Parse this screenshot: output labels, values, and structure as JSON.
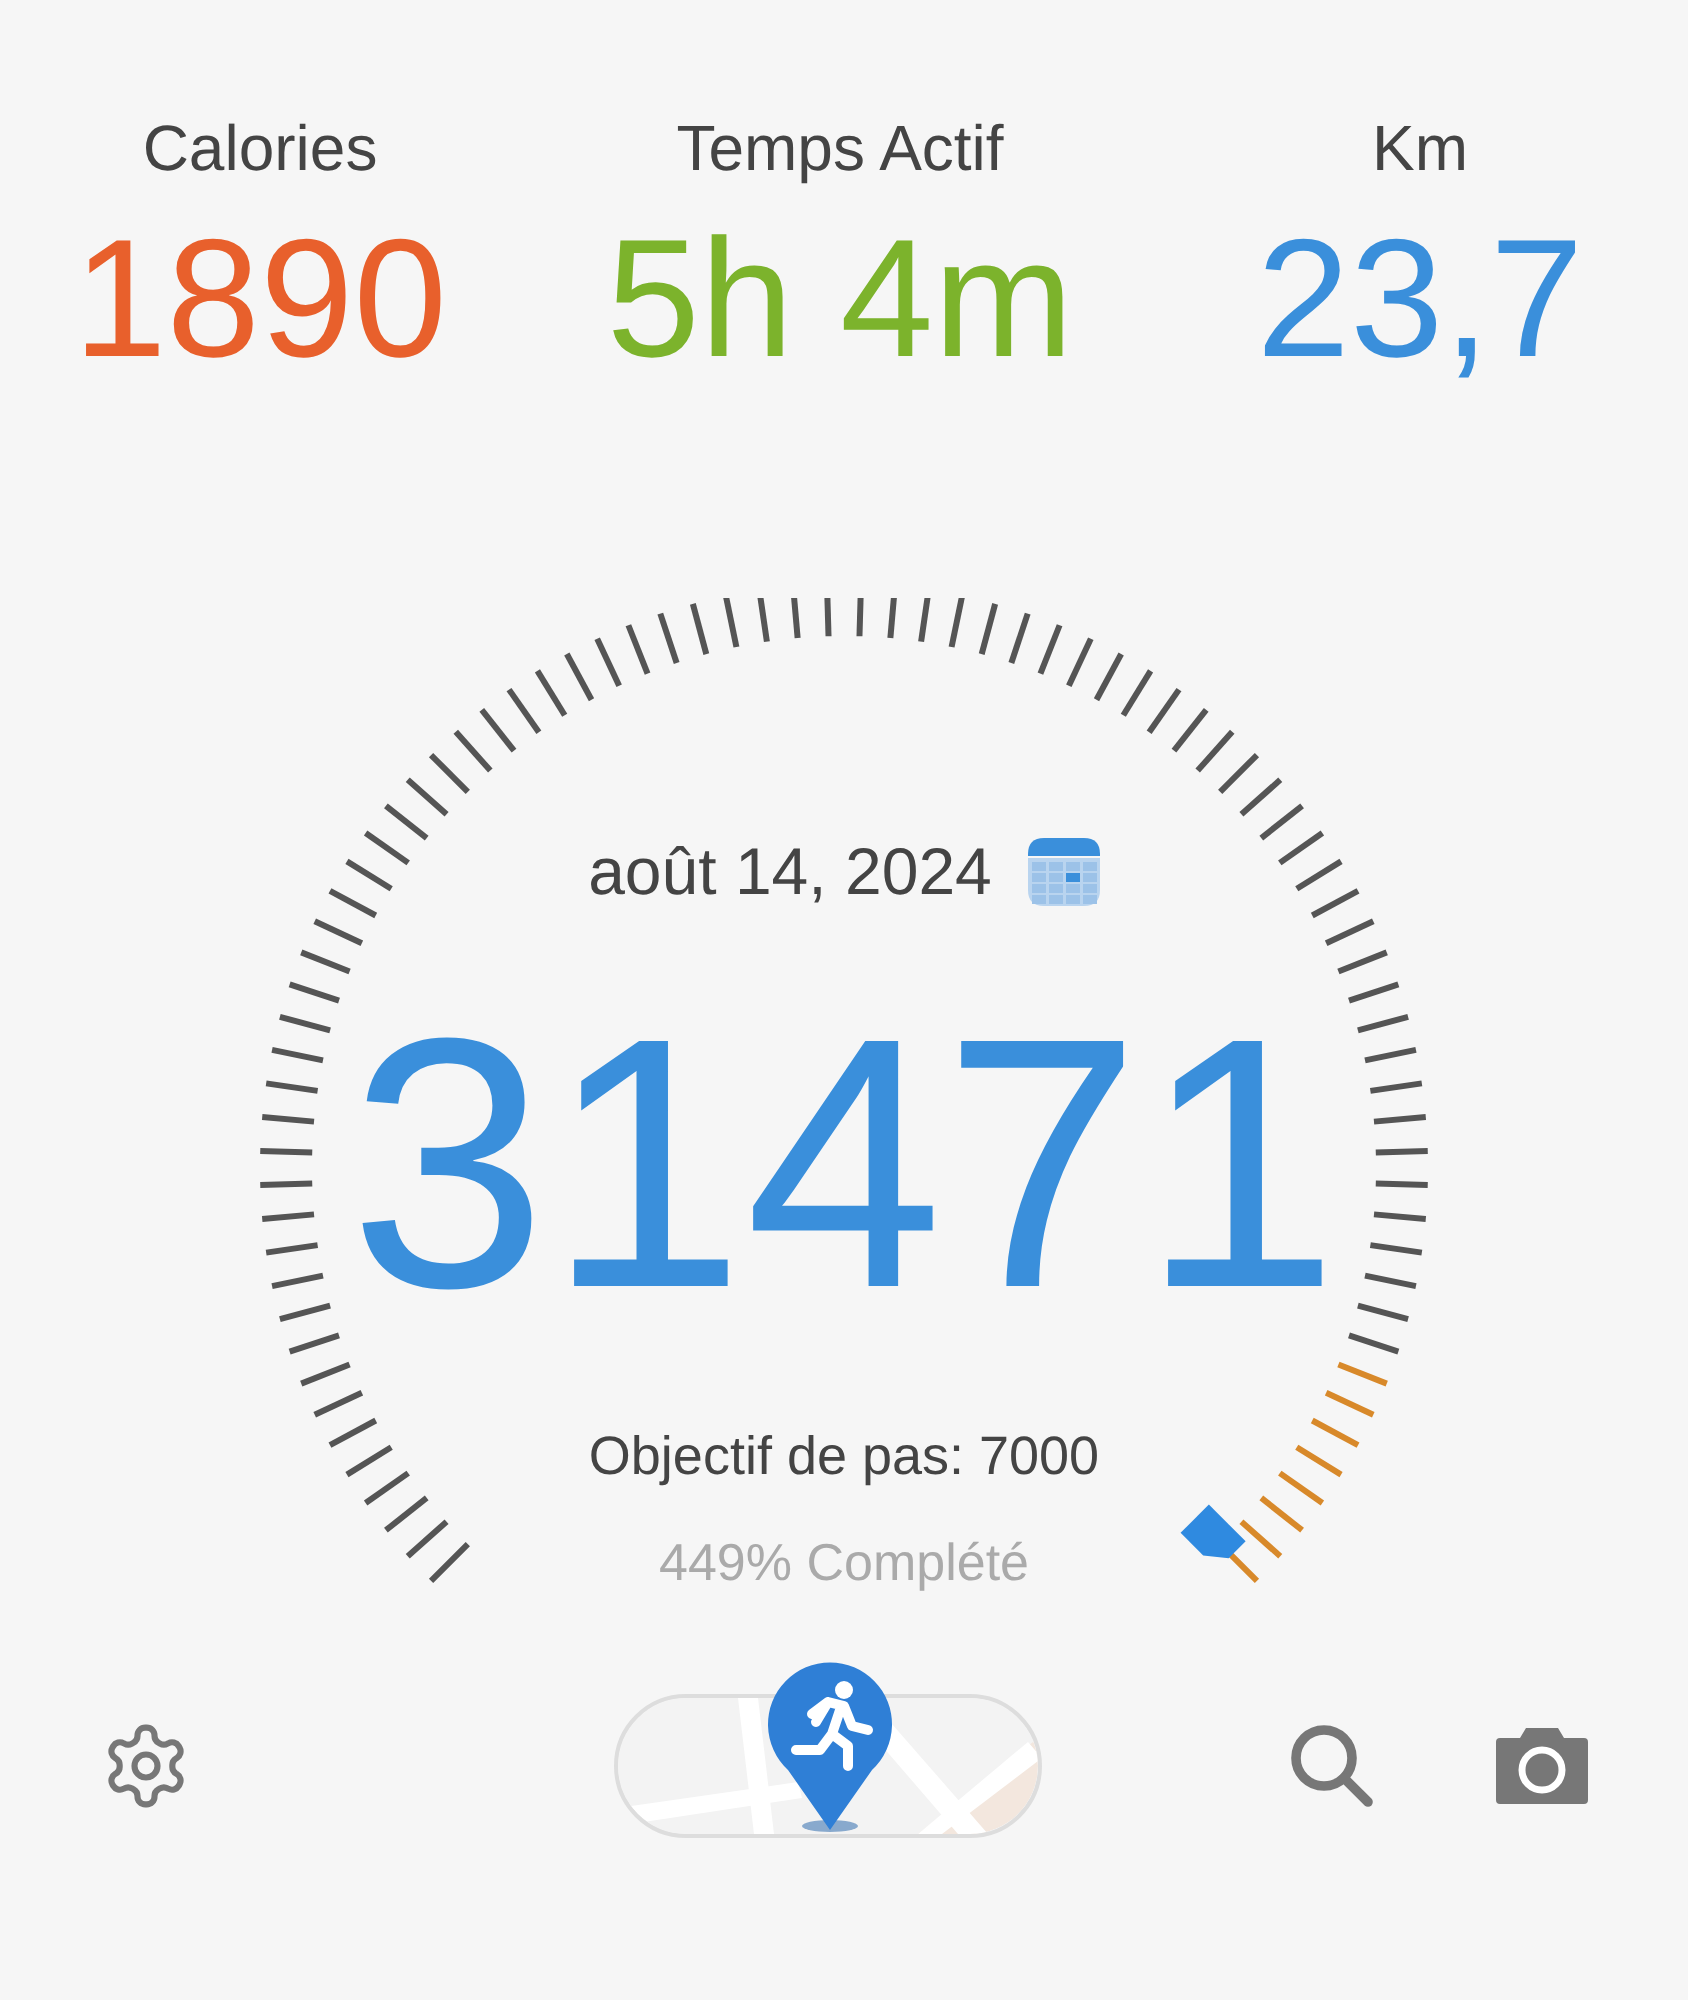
{
  "stats": [
    {
      "label": "Calories",
      "value": "1890",
      "color": "#e8602c"
    },
    {
      "label": "Temps Actif",
      "value": "5h 4m",
      "color": "#7cb32c"
    },
    {
      "label": "Km",
      "value": "23,7",
      "color": "#3a8fdb"
    }
  ],
  "gauge": {
    "date": "août 14, 2024",
    "steps": "31471",
    "goal": "Objectif de pas: 7000",
    "completion": "449% Complété"
  }
}
